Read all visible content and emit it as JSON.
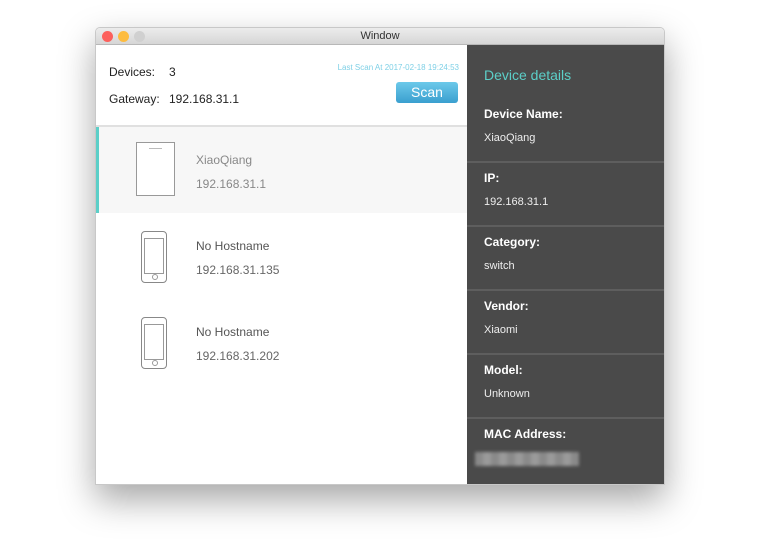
{
  "window": {
    "title": "Window"
  },
  "header": {
    "devices_label": "Devices:",
    "devices_count": "3",
    "gateway_label": "Gateway:",
    "gateway_ip": "192.168.31.1",
    "last_scan": "Last Scan At 2017-02-18 19:24:53",
    "scan_label": "Scan"
  },
  "devices": [
    {
      "name": "XiaoQiang",
      "ip": "192.168.31.1",
      "icon": "tablet-icon"
    },
    {
      "name": "No Hostname",
      "ip": "192.168.31.135",
      "icon": "phone-icon"
    },
    {
      "name": "No Hostname",
      "ip": "192.168.31.202",
      "icon": "phone-icon"
    }
  ],
  "details": {
    "title": "Device details",
    "fields": [
      {
        "label": "Device Name:",
        "value": "XiaoQiang"
      },
      {
        "label": "IP:",
        "value": "192.168.31.1"
      },
      {
        "label": "Category:",
        "value": "switch"
      },
      {
        "label": "Vendor:",
        "value": "Xiaomi"
      },
      {
        "label": "Model:",
        "value": "Unknown"
      },
      {
        "label": "MAC Address:"
      }
    ]
  },
  "colors": {
    "accent": "#5ccfc8",
    "panel": "#4a4a4a",
    "scan": "#3a9fcf"
  }
}
